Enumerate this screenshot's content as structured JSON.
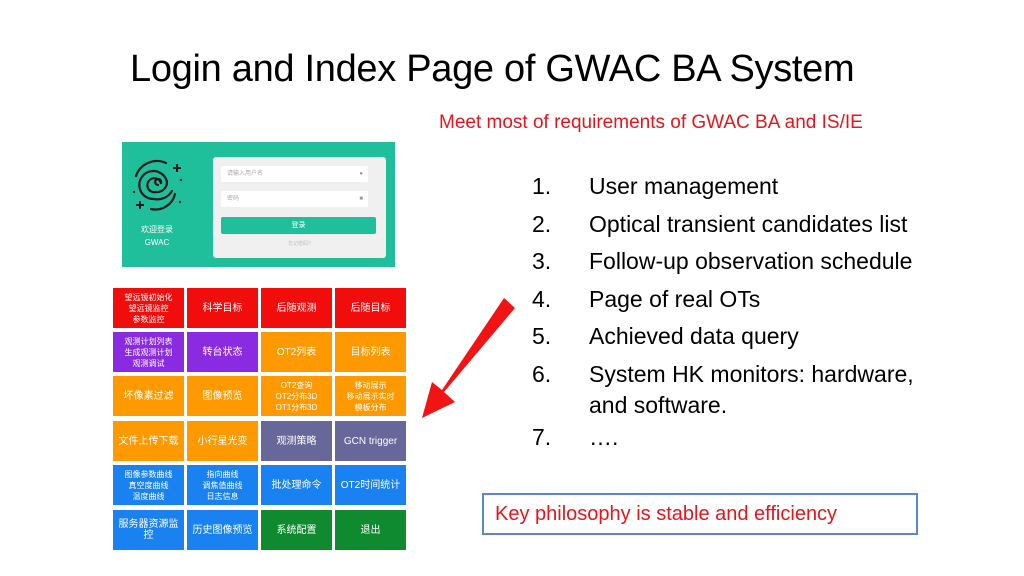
{
  "slide": {
    "title": "Login and Index Page of GWAC BA System",
    "subtitle": "Meet most of requirements of GWAC BA and IS/IE",
    "accent_color": "#e8141a"
  },
  "login": {
    "welcome_line1": "欢迎登录",
    "welcome_line2": "GWAC",
    "username_placeholder": "请输入用户名",
    "password_placeholder": "密码",
    "login_button": "登录",
    "forgot_link": "忘记密码?",
    "brand_color": "#1fbf9b"
  },
  "index_grid": {
    "tiles": [
      {
        "label": "望远镜初始化\n望远镜监控\n参数监控",
        "color": "#f20d0d"
      },
      {
        "label": "科学目标",
        "color": "#f20d0d"
      },
      {
        "label": "后随观测",
        "color": "#f20d0d"
      },
      {
        "label": "后随目标",
        "color": "#f20d0d"
      },
      {
        "label": "观测计划列表\n生成观测计划\n观测调试",
        "color": "#8a2be2"
      },
      {
        "label": "转台状态",
        "color": "#8a2be2"
      },
      {
        "label": "OT2列表",
        "color": "#ff9900"
      },
      {
        "label": "目标列表",
        "color": "#ff9900"
      },
      {
        "label": "坏像素过滤",
        "color": "#ff9900"
      },
      {
        "label": "图像预览",
        "color": "#ff9900"
      },
      {
        "label": "OT2查询\nOT2分布3D\nOT1分布3D",
        "color": "#ff9900"
      },
      {
        "label": "移动展示\n移动展示实时\n模板分布",
        "color": "#ff9900"
      },
      {
        "label": "文件上传下载",
        "color": "#ff9900"
      },
      {
        "label": "小行星光变",
        "color": "#ff9900"
      },
      {
        "label": "观测策略",
        "color": "#68679a"
      },
      {
        "label": "GCN trigger",
        "color": "#68679a"
      },
      {
        "label": "图像参数曲线\n真空度曲线\n温度曲线",
        "color": "#1a82f0"
      },
      {
        "label": "指向曲线\n调焦值曲线\n日志信息",
        "color": "#1a82f0"
      },
      {
        "label": "批处理命令",
        "color": "#1a82f0"
      },
      {
        "label": "OT2时间统计",
        "color": "#1a82f0"
      },
      {
        "label": "服务器资源监控",
        "color": "#1a82f0"
      },
      {
        "label": "历史图像预览",
        "color": "#1a82f0"
      },
      {
        "label": "系统配置",
        "color": "#108a2e"
      },
      {
        "label": "退出",
        "color": "#108a2e"
      }
    ]
  },
  "features": [
    {
      "num": "1.",
      "text": "User management"
    },
    {
      "num": "2.",
      "text": "Optical transient candidates list"
    },
    {
      "num": "3.",
      "text": "Follow-up observation  schedule"
    },
    {
      "num": "4.",
      "text": "Page of real OTs"
    },
    {
      "num": "5.",
      "text": "Achieved data query"
    },
    {
      "num": "6.",
      "text": "System HK monitors: hardware,",
      "text2": "and software."
    },
    {
      "num": "7.",
      "text": "…."
    }
  ],
  "key_box": {
    "text": "Key philosophy is stable and efficiency",
    "border_color": "#5b87c7"
  },
  "icons": {
    "user": "user-icon",
    "lock": "lock-icon",
    "galaxy": "galaxy-logo-icon",
    "arrow": "red-arrow-icon"
  }
}
